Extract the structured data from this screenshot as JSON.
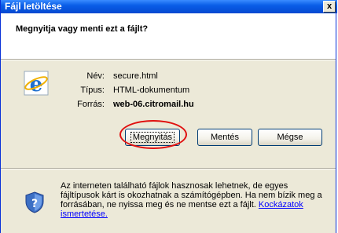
{
  "window": {
    "title": "Fájl letöltése",
    "close_label": "x"
  },
  "prompt": {
    "question": "Megnyitja vagy menti ezt a fájlt?"
  },
  "file": {
    "name_label": "Név:",
    "name_value": "secure.html",
    "type_label": "Típus:",
    "type_value": "HTML-dokumentum",
    "source_label": "Forrás:",
    "source_value": "web-06.citromail.hu"
  },
  "buttons": {
    "open": "Megnyitás",
    "save": "Mentés",
    "cancel": "Mégse"
  },
  "warning": {
    "text": "Az interneten található fájlok hasznosak lehetnek, de egyes fájltípusok kárt is okozhatnak a számítógépben. Ha nem bízik meg a forrásában, ne nyissa meg és ne mentse ezt a fájlt.",
    "link": "Kockázatok ismertetése."
  },
  "icons": {
    "file": "internet-explorer-icon",
    "warning": "shield-icon"
  },
  "colors": {
    "titlebar": "#0a5ee8",
    "highlight_circle": "#e01010",
    "link": "#0000ff",
    "dialog_bg": "#ece9d8"
  }
}
